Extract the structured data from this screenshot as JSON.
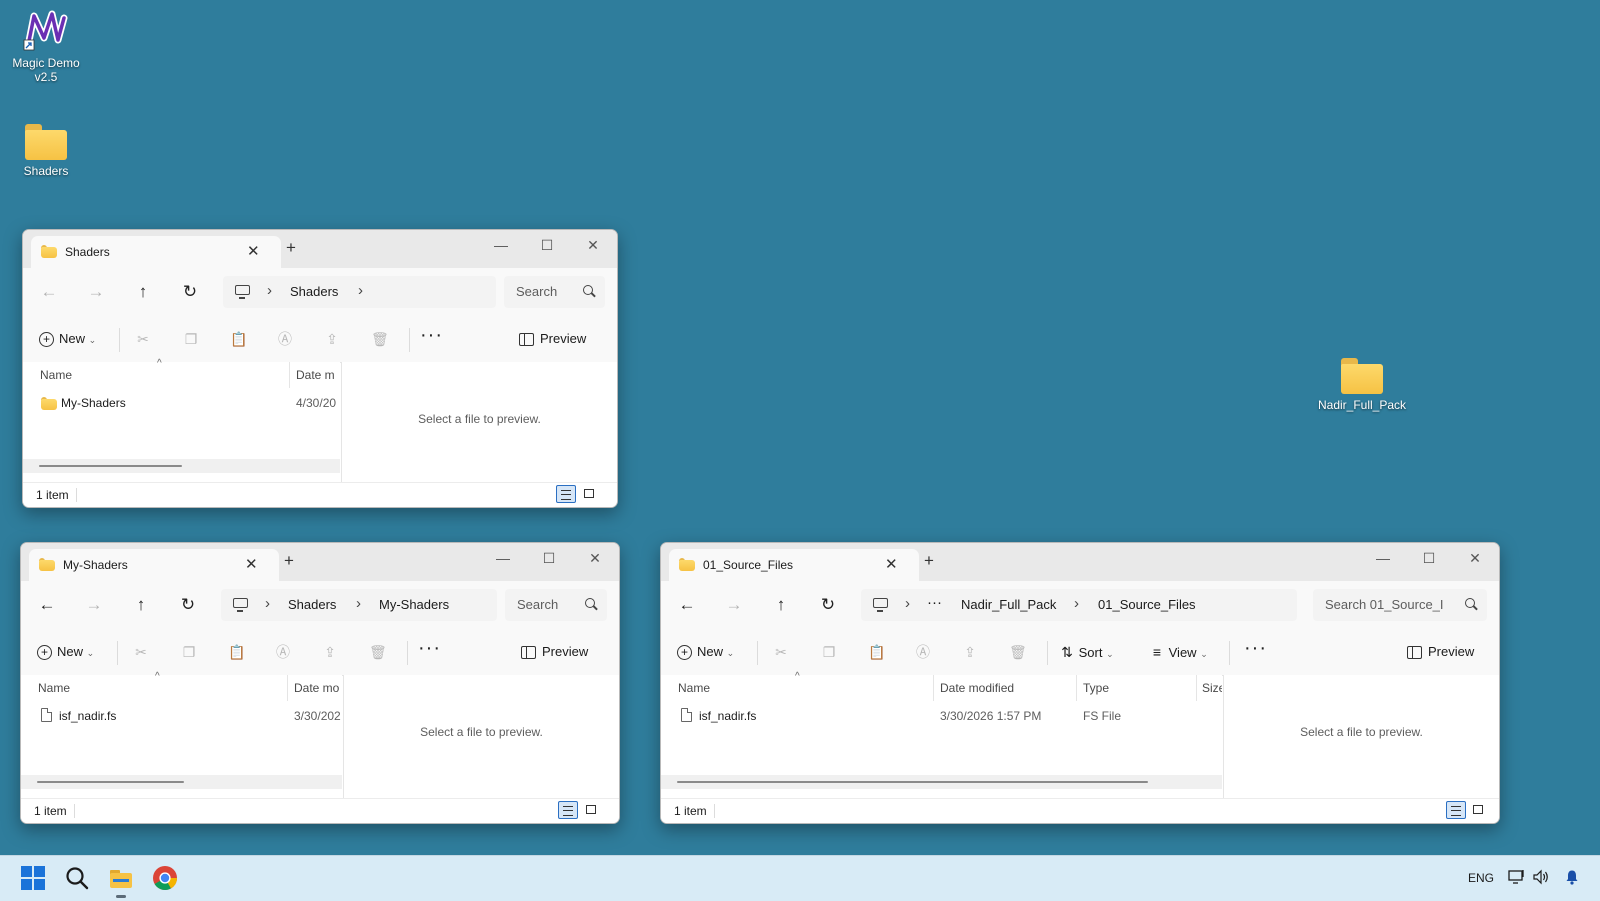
{
  "desktop": {
    "icons": [
      {
        "label_line1": "Magic Demo",
        "label_line2": "v2.5",
        "icon": "magic-app-icon"
      },
      {
        "label": "Shaders",
        "icon": "folder-icon"
      },
      {
        "label": "Nadir_Full_Pack",
        "icon": "folder-icon"
      }
    ]
  },
  "common": {
    "search_placeholder": "Search",
    "new_label": "New",
    "preview_label": "Preview",
    "preview_message": "Select a file to preview.",
    "status_count": "1 item",
    "col_name": "Name"
  },
  "windows": [
    {
      "tab_title": "Shaders",
      "breadcrumb": [
        "Shaders"
      ],
      "col_date": "Date m",
      "row": {
        "name": "My-Shaders",
        "date": "4/30/20",
        "kind": "folder"
      }
    },
    {
      "tab_title": "My-Shaders",
      "breadcrumb": [
        "Shaders",
        "My-Shaders"
      ],
      "col_date": "Date mo",
      "row": {
        "name": "isf_nadir.fs",
        "date": "3/30/202",
        "kind": "file"
      }
    },
    {
      "tab_title": "01_Source_Files",
      "breadcrumb": [
        "Nadir_Full_Pack",
        "01_Source_Files"
      ],
      "search_placeholder": "Search 01_Source_I",
      "sort_label": "Sort",
      "view_label": "View",
      "col_date": "Date modified",
      "col_type": "Type",
      "col_size": "Size",
      "row": {
        "name": "isf_nadir.fs",
        "date": "3/30/2026 1:57 PM",
        "type": "FS File",
        "kind": "file"
      }
    }
  ],
  "taskbar": {
    "language": "ENG",
    "icons": [
      "start-icon",
      "search-icon",
      "file-explorer-icon",
      "chrome-icon"
    ],
    "tray_icons": [
      "network-icon",
      "volume-icon",
      "notification-bell-icon"
    ]
  },
  "colors": {
    "desktop": "#2f7d9c",
    "taskbar": "#d8ebf6",
    "folder": "#f6c244",
    "accent": "#2b6fc2"
  }
}
